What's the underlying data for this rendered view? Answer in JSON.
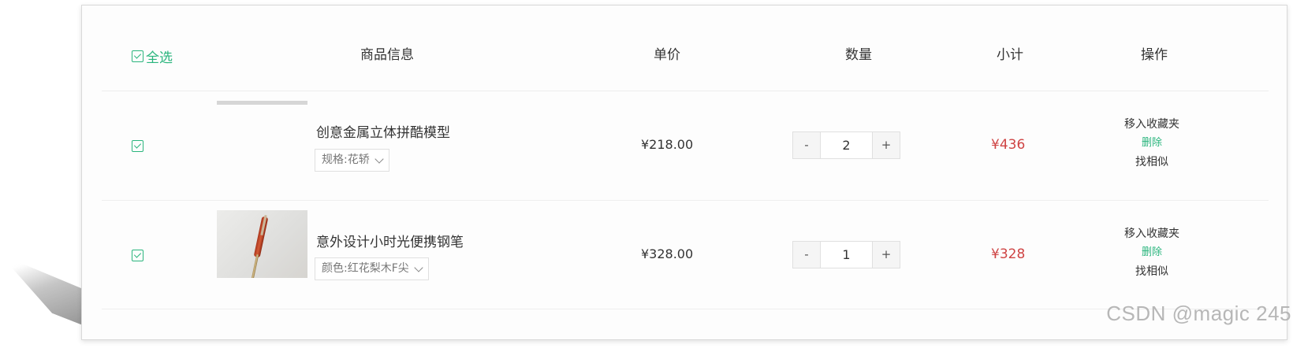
{
  "header": {
    "select_all_label": "全选",
    "col_info": "商品信息",
    "col_price": "单价",
    "col_qty": "数量",
    "col_subtotal": "小计",
    "col_ops": "操作"
  },
  "items": [
    {
      "name": "创意金属立体拼酷模型",
      "spec": "规格:花轿",
      "price": "¥218.00",
      "quantity": "2",
      "subtotal": "¥436",
      "checked": true,
      "image_state": "loading"
    },
    {
      "name": "意外设计小时光便携钢笔",
      "spec": "颜色:红花梨木F尖",
      "price": "¥328.00",
      "quantity": "1",
      "subtotal": "¥328",
      "checked": true,
      "image_state": "pen-photo"
    }
  ],
  "stepper": {
    "minus": "-",
    "plus": "+"
  },
  "ops": {
    "move_to_favorites": "移入收藏夹",
    "delete": "删除",
    "find_similar": "找相似"
  },
  "watermark": "CSDN @magic 245",
  "colors": {
    "accent_green": "#2ab57d",
    "price_red": "#cf4444",
    "text": "#333333",
    "border": "#e0e0e0"
  },
  "icons": {
    "checkbox": "checkbox-checked-icon",
    "dropdown": "chevron-down-icon"
  }
}
